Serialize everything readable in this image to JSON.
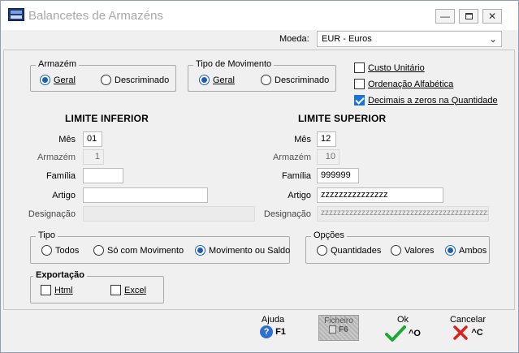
{
  "window": {
    "title": "Balancetes de Armazéns"
  },
  "moeda": {
    "label": "Moeda:",
    "value": "EUR - Euros"
  },
  "armazem": {
    "legend": "Armazém",
    "options": [
      {
        "label": "Geral",
        "selected": true
      },
      {
        "label": "Descriminado",
        "selected": false
      }
    ]
  },
  "tipo_movimento": {
    "legend": "Tipo de Movimento",
    "options": [
      {
        "label": "Geral",
        "selected": true
      },
      {
        "label": "Descriminado",
        "selected": false
      }
    ]
  },
  "checks": [
    {
      "label": "Custo Unitário",
      "checked": false
    },
    {
      "label": "Ordenação Alfabética",
      "checked": false
    },
    {
      "label": "Decimais a zeros na Quantidade",
      "checked": true
    }
  ],
  "limite_inferior": {
    "heading": "LIMITE INFERIOR",
    "mes_label": "Mês",
    "mes": "01",
    "armazem_label": "Armazém",
    "armazem": "1",
    "familia_label": "Família",
    "familia": "",
    "artigo_label": "Artigo",
    "artigo": "",
    "designacao_label": "Designação",
    "designacao": ""
  },
  "limite_superior": {
    "heading": "LIMITE SUPERIOR",
    "mes_label": "Mês",
    "mes": "12",
    "armazem_label": "Armazém",
    "armazem": "10",
    "familia_label": "Família",
    "familia": "999999",
    "artigo_label": "Artigo",
    "artigo": "zzzzzzzzzzzzzzz",
    "designacao_label": "Designação",
    "designacao": "zzzzzzzzzzzzzzzzzzzzzzzzzzzzzzzzzzzzzzzzzzzzzz"
  },
  "tipo": {
    "legend": "Tipo",
    "options": [
      {
        "label": "Todos",
        "selected": false
      },
      {
        "label": "Só com Movimento",
        "selected": false
      },
      {
        "label": "Movimento ou Saldo",
        "selected": true
      }
    ]
  },
  "opcoes": {
    "legend": "Opções",
    "options": [
      {
        "label": "Quantidades",
        "selected": false
      },
      {
        "label": "Valores",
        "selected": false
      },
      {
        "label": "Ambos",
        "selected": true
      }
    ]
  },
  "exportacao": {
    "legend": "Exportação",
    "options": [
      {
        "label": "Html",
        "checked": false
      },
      {
        "label": "Excel",
        "checked": false
      }
    ]
  },
  "footer": {
    "ajuda": {
      "label": "Ajuda",
      "key": "F1",
      "icon": "help-icon"
    },
    "ficheiro": {
      "label": "Ficheiro",
      "key": "F6",
      "icon": "file-icon"
    },
    "ok": {
      "label": "Ok",
      "key": "^O",
      "icon": "check-icon",
      "color": "#1fa83a"
    },
    "cancelar": {
      "label": "Cancelar",
      "key": "^C",
      "icon": "cross-icon",
      "color": "#d9231d"
    }
  }
}
